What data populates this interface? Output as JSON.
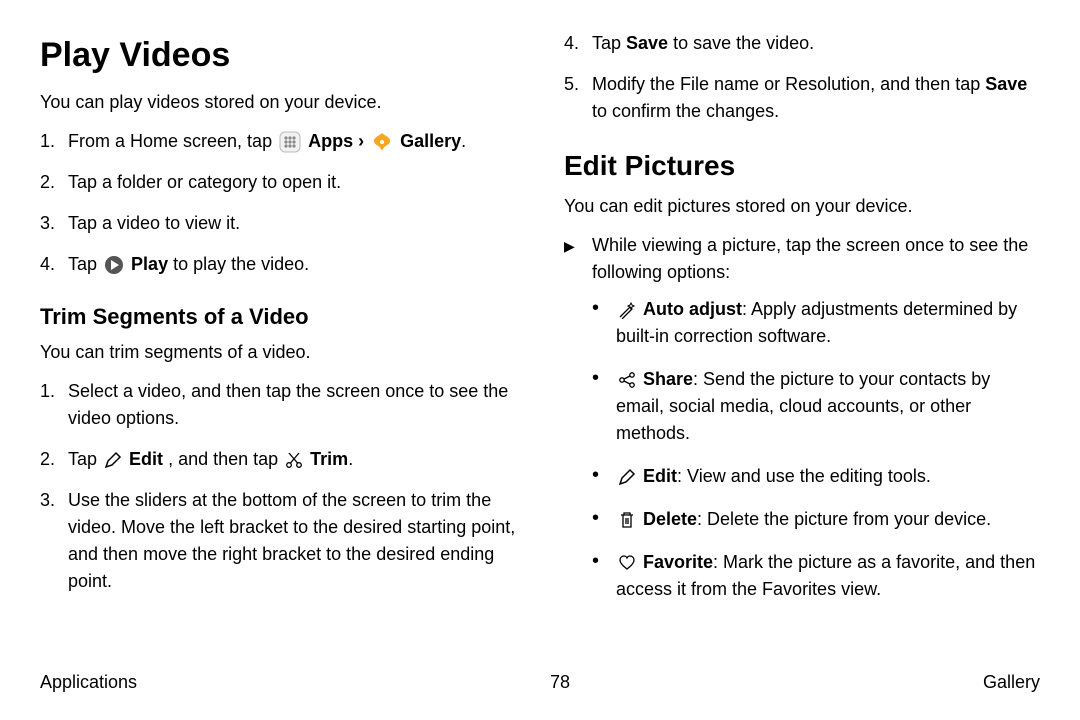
{
  "left": {
    "h1": "Play Videos",
    "intro": "You can play videos stored on your device.",
    "step1_a": "From a Home screen, tap ",
    "step1_apps": "Apps",
    "step1_sep": " › ",
    "step1_gallery": "Gallery",
    "step1_end": ".",
    "step2": "Tap a folder or category to open it.",
    "step3": "Tap a video to view it.",
    "step4_a": "Tap ",
    "step4_play": "Play",
    "step4_b": " to play the video.",
    "sub": "Trim Segments of a Video",
    "sub_intro": "You can trim segments of a video.",
    "t1": "Select a video, and then tap the screen once to see the video options.",
    "t2_a": "Tap ",
    "t2_edit": "Edit",
    "t2_b": ", and then tap ",
    "t2_trim": "Trim",
    "t2_c": ".",
    "t3": "Use the sliders at the bottom of the screen to trim the video. Move the left bracket to the desired starting point, and then move the right bracket to the desired ending point."
  },
  "right": {
    "s4_a": "Tap ",
    "s4_save": "Save",
    "s4_b": " to save the video.",
    "s5_a": "Modify the File name or Resolution, and then tap ",
    "s5_save": "Save",
    "s5_b": " to confirm the changes.",
    "h2": "Edit Pictures",
    "intro": "You can edit pictures stored on your device.",
    "arrow1": "While viewing a picture, tap the screen once to see the following options:",
    "auto_b": "Auto adjust",
    "auto_t": ": Apply adjustments determined by built-in correction software.",
    "share_b": "Share",
    "share_t": ": Send the picture to your contacts by email, social media, cloud accounts, or other methods.",
    "edit_b": "Edit",
    "edit_t": ": View and use the editing tools.",
    "del_b": "Delete",
    "del_t": ": Delete the picture from your device.",
    "fav_b": "Favorite",
    "fav_t": ": Mark the picture as a favorite, and then access it from the Favorites view."
  },
  "footer": {
    "left": "Applications",
    "center": "78",
    "right": "Gallery"
  }
}
